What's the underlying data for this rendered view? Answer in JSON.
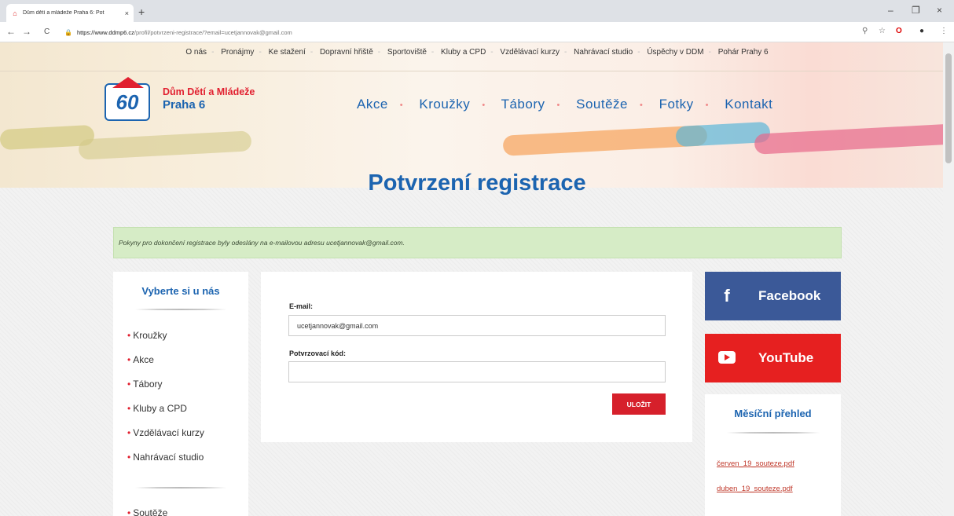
{
  "browser": {
    "tab_title": "Dům dětí a mládeže Praha 6: Pot",
    "tab_close": "×",
    "new_tab": "+",
    "url_host": "https://www.ddmp6.cz",
    "url_path": "/profil/potvrzeni-registrace/?email=ucetjannovak@gmail.com",
    "back": "←",
    "forward": "→",
    "reload": "C",
    "minimize": "–",
    "maximize": "❐",
    "close": "×"
  },
  "topnav": {
    "items": [
      "O nás",
      "Pronájmy",
      "Ke stažení",
      "Dopravní hřiště",
      "Sportoviště",
      "Kluby a CPD",
      "Vzdělávací kurzy",
      "Nahrávací studio",
      "Úspěchy v DDM",
      "Pohár Prahy 6"
    ],
    "separator": "-"
  },
  "brand": {
    "logo_text": "60",
    "line1": "Dům Dětí a Mládeže",
    "line2": "Praha 6"
  },
  "mainnav": {
    "items": [
      "Akce",
      "Kroužky",
      "Tábory",
      "Soutěže",
      "Fotky",
      "Kontakt"
    ],
    "dot": "•"
  },
  "page_title": "Potvrzení registrace",
  "notice": "Pokyny pro dokončení registrace byly odeslány na e-mailovou adresu ucetjannovak@gmail.com.",
  "sidebar": {
    "heading": "Vyberte si u nás",
    "items": [
      "Kroužky",
      "Akce",
      "Tábory",
      "Kluby a CPD",
      "Vzdělávací kurzy",
      "Nahrávací studio"
    ],
    "bullet": "•",
    "items_below": [
      "Soutěže"
    ]
  },
  "form": {
    "email_label": "E-mail:",
    "email_value": "ucetjannovak@gmail.com",
    "code_label": "Potvrzovací kód:",
    "code_value": "",
    "submit_label": "ULOŽIT"
  },
  "social": {
    "facebook_icon": "f",
    "facebook_label": "Facebook",
    "youtube_label": "YouTube"
  },
  "monthly": {
    "heading": "Měsíční přehled",
    "links": [
      "červen_19_souteze.pdf",
      "duben_19_souteze.pdf"
    ]
  },
  "colors": {
    "brand_blue": "#1c64b0",
    "brand_red": "#e11f2f",
    "facebook": "#3b5998",
    "youtube": "#e62020",
    "notice_bg": "#d6ecc6"
  }
}
